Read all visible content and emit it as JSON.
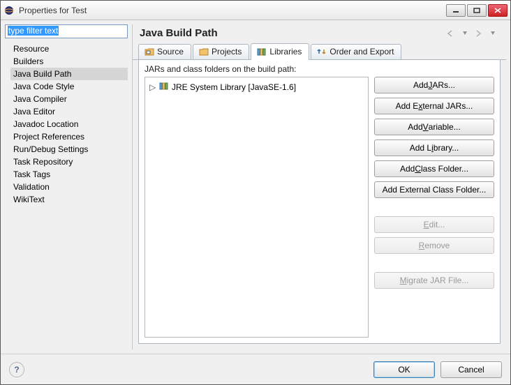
{
  "window": {
    "title": "Properties for Test"
  },
  "sidebar": {
    "filter_text": "type filter text",
    "items": [
      {
        "label": "Resource"
      },
      {
        "label": "Builders"
      },
      {
        "label": "Java Build Path"
      },
      {
        "label": "Java Code Style"
      },
      {
        "label": "Java Compiler"
      },
      {
        "label": "Java Editor"
      },
      {
        "label": "Javadoc Location"
      },
      {
        "label": "Project References"
      },
      {
        "label": "Run/Debug Settings"
      },
      {
        "label": "Task Repository"
      },
      {
        "label": "Task Tags"
      },
      {
        "label": "Validation"
      },
      {
        "label": "WikiText"
      }
    ],
    "selected": "Java Build Path"
  },
  "main": {
    "title": "Java Build Path",
    "tabs": [
      {
        "label": "Source",
        "icon": "source-folder-icon"
      },
      {
        "label": "Projects",
        "icon": "projects-icon"
      },
      {
        "label": "Libraries",
        "icon": "libraries-icon"
      },
      {
        "label": "Order and Export",
        "icon": "order-export-icon"
      }
    ],
    "active_tab": "Libraries",
    "build_label": "JARs and class folders on the build path:",
    "tree": [
      {
        "label": "JRE System Library [JavaSE-1.6]",
        "icon": "library-icon"
      }
    ],
    "buttons": [
      {
        "label": "Add JARs...",
        "u": "J",
        "enabled": true
      },
      {
        "label": "Add External JARs...",
        "u": "x",
        "enabled": true
      },
      {
        "label": "Add Variable...",
        "u": "V",
        "enabled": true
      },
      {
        "label": "Add Library...",
        "u": "i",
        "enabled": true
      },
      {
        "label": "Add Class Folder...",
        "u": "C",
        "enabled": true
      },
      {
        "label": "Add External Class Folder...",
        "u": "",
        "enabled": true
      },
      {
        "spacer": true
      },
      {
        "label": "Edit...",
        "u": "E",
        "enabled": false
      },
      {
        "label": "Remove",
        "u": "R",
        "enabled": false
      },
      {
        "spacer": true
      },
      {
        "label": "Migrate JAR File...",
        "u": "M",
        "enabled": false
      }
    ]
  },
  "footer": {
    "ok": "OK",
    "cancel": "Cancel",
    "help": "?"
  }
}
